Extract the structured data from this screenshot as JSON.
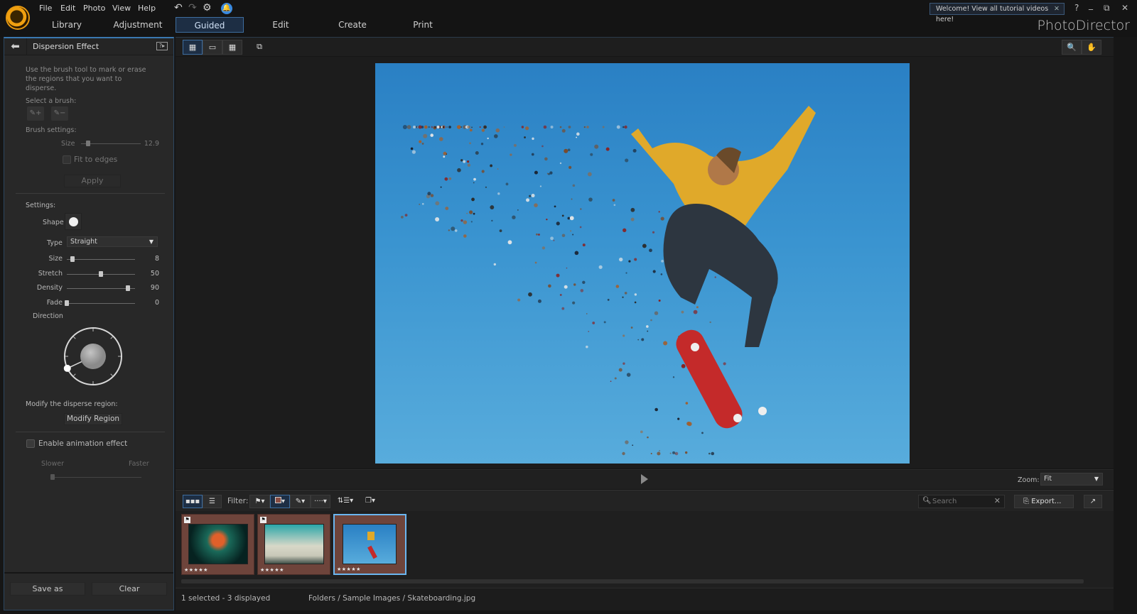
{
  "app": {
    "brand": "PhotoDirector",
    "menu": [
      "File",
      "Edit",
      "Photo",
      "View",
      "Help"
    ],
    "toolbar_icons": [
      "undo-icon",
      "redo-icon",
      "settings-icon",
      "notification-bell-icon"
    ],
    "tutorial_banner": "Welcome! View all tutorial videos here!",
    "window_controls": {
      "help": "?",
      "minimize": "_",
      "restore": "⧉",
      "close": "✕"
    }
  },
  "nav_tabs": [
    {
      "label": "Library",
      "active": false
    },
    {
      "label": "Adjustment",
      "active": false
    },
    {
      "label": "Guided",
      "active": true
    },
    {
      "label": "Edit",
      "active": false
    },
    {
      "label": "Create",
      "active": false
    },
    {
      "label": "Print",
      "active": false
    }
  ],
  "panel": {
    "title": "Dispersion Effect",
    "instructions": "Use the brush tool to mark or erase the regions that you want to disperse.",
    "select_brush_label": "Select a brush:",
    "brush_settings_label": "Brush settings:",
    "brush_size_label": "Size",
    "brush_size_value": "12.9",
    "brush_size_fraction": 0.12,
    "fit_to_edges_label": "Fit to edges",
    "fit_to_edges_checked": false,
    "apply_label": "Apply",
    "settings_label": "Settings:",
    "shape_label": "Shape",
    "type_label": "Type",
    "type_value": "Straight",
    "sliders": [
      {
        "label": "Size",
        "value": "8",
        "fraction": 0.08
      },
      {
        "label": "Stretch",
        "value": "50",
        "fraction": 0.5
      },
      {
        "label": "Density",
        "value": "90",
        "fraction": 0.9
      },
      {
        "label": "Fade",
        "value": "0",
        "fraction": 0.0
      }
    ],
    "direction_label": "Direction",
    "direction_angle_deg": 205,
    "modify_label": "Modify the disperse region:",
    "modify_button": "Modify Region",
    "animation_label": "Enable animation effect",
    "animation_checked": false,
    "slower_label": "Slower",
    "faster_label": "Faster",
    "speed_fraction": 0.0,
    "save_as_label": "Save as",
    "clear_label": "Clear"
  },
  "viewer": {
    "view_modes": [
      "single-view-icon",
      "compare-view-icon",
      "grid-view-icon",
      "dual-monitor-icon"
    ],
    "zoom_label": "Zoom:",
    "zoom_value": "Fit",
    "tools": [
      "zoom-tool-icon",
      "hand-tool-icon"
    ]
  },
  "filmstrip": {
    "filter_label": "Filter:",
    "search_placeholder": "Search",
    "export_label": "Export...",
    "thumbnails": [
      {
        "name": "maple-leaf",
        "rating": "★★★★★",
        "flagged": true,
        "selected": false
      },
      {
        "name": "rocket-launch",
        "rating": "★★★★★",
        "flagged": true,
        "selected": false
      },
      {
        "name": "skateboarding",
        "rating": "★★★★★",
        "flagged": false,
        "selected": true
      }
    ]
  },
  "status": {
    "selection": "1 selected - 3 displayed",
    "path": "Folders / Sample Images / Skateboarding.jpg"
  }
}
